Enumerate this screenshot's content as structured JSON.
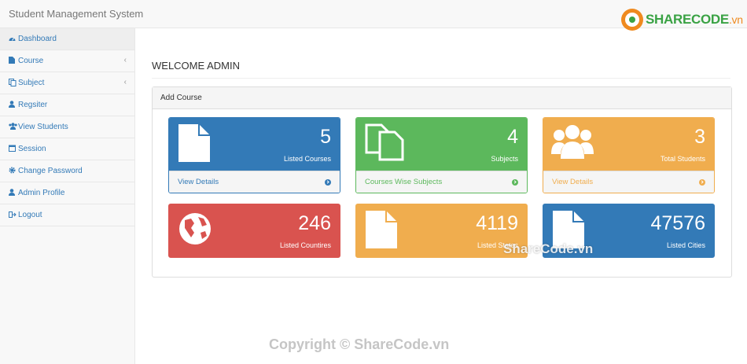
{
  "header": {
    "brand": "Student Management System"
  },
  "logo": {
    "name": "SHARECODE",
    "domain": ".vn"
  },
  "sidebar": {
    "items": [
      {
        "label": "Dashboard",
        "icon": "dashboard-icon",
        "active": true
      },
      {
        "label": "Course",
        "icon": "file-icon",
        "has_arrow": true
      },
      {
        "label": "Subject",
        "icon": "files-icon",
        "has_arrow": true
      },
      {
        "label": "Regsiter",
        "icon": "user-icon"
      },
      {
        "label": "View Students",
        "icon": "users-icon"
      },
      {
        "label": "Session",
        "icon": "calendar-icon"
      },
      {
        "label": "Change Password",
        "icon": "gear-icon"
      },
      {
        "label": "Admin Profile",
        "icon": "user-icon"
      },
      {
        "label": "Logout",
        "icon": "sign-out-icon"
      }
    ]
  },
  "main": {
    "title": "WELCOME ADMIN",
    "panel_heading": "Add Course",
    "tiles": [
      {
        "value": "5",
        "label": "Listed Courses",
        "footer": "View Details",
        "color": "#337ab7",
        "icon": "file-icon"
      },
      {
        "value": "4",
        "label": "Subjects",
        "footer": "Courses Wise Subjects",
        "color": "#5cb85c",
        "icon": "files-icon"
      },
      {
        "value": "3",
        "label": "Total Students",
        "footer": "View Details",
        "color": "#f0ad4e",
        "icon": "users-icon"
      },
      {
        "value": "246",
        "label": "Listed Countires",
        "color": "#d9534f",
        "icon": "globe-icon"
      },
      {
        "value": "4119",
        "label": "Listed States",
        "color": "#f0ad4e",
        "icon": "file-icon"
      },
      {
        "value": "47576",
        "label": "Listed Cities",
        "color": "#337ab7",
        "icon": "file-icon"
      }
    ]
  },
  "watermarks": {
    "overlay": "ShareCode.vn",
    "copyright": "Copyright © ShareCode.vn"
  }
}
